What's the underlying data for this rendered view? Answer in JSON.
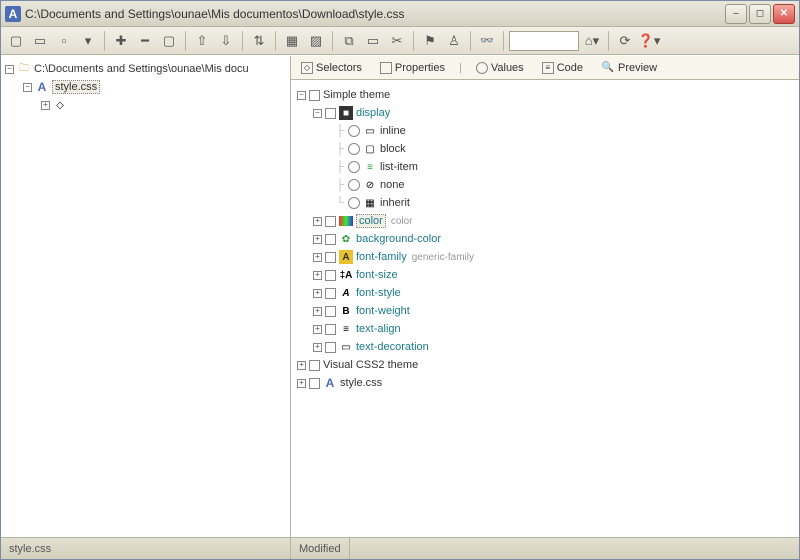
{
  "window": {
    "title": "C:\\Documents and Settings\\ounae\\Mis documentos\\Download\\style.css"
  },
  "left_tree": {
    "root": "C:\\Documents and Settings\\ounae\\Mis docu",
    "file": "style.css"
  },
  "tabs": {
    "selectors": "Selectors",
    "properties": "Properties",
    "values": "Values",
    "code": "Code",
    "preview": "Preview"
  },
  "tree": {
    "simple_theme": "Simple theme",
    "display": {
      "label": "display",
      "inline": "inline",
      "block": "block",
      "list_item": "list-item",
      "none": "none",
      "inherit": "inherit"
    },
    "color": {
      "label": "color",
      "hint": "color"
    },
    "background_color": "background-color",
    "font_family": {
      "label": "font-family",
      "hint": "generic-family"
    },
    "font_size": "font-size",
    "font_style": "font-style",
    "font_weight": "font-weight",
    "text_align": "text-align",
    "text_decoration": "text-decoration",
    "visual_css2": "Visual CSS2 theme",
    "style_css": "style.css"
  },
  "status": {
    "file": "style.css",
    "state": "Modified"
  }
}
